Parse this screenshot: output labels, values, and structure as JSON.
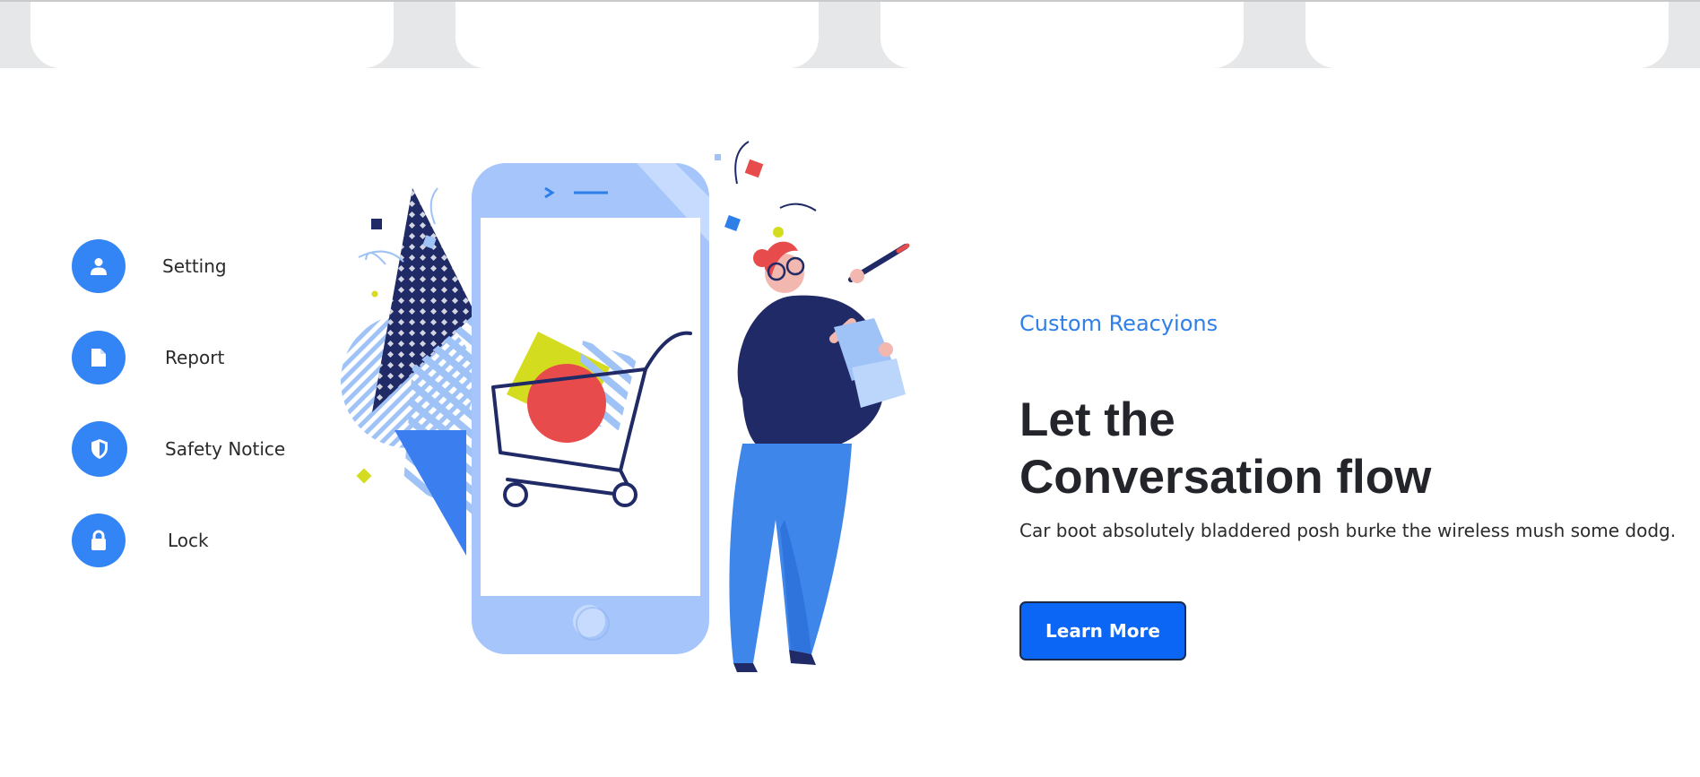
{
  "features": [
    {
      "label": "Setting",
      "icon": "user-icon"
    },
    {
      "label": "Report",
      "icon": "document-icon"
    },
    {
      "label": "Safety Notice",
      "icon": "shield-icon"
    },
    {
      "label": "Lock",
      "icon": "lock-icon"
    }
  ],
  "hero": {
    "eyebrow": "Custom Reacyions",
    "headline_line1": "Let the",
    "headline_line2": "Conversation flow",
    "body": "Car boot absolutely bladdered posh burke the wireless mush some dodg.",
    "cta_label": "Learn More"
  },
  "colors": {
    "accent": "#3385f5",
    "cta": "#0b66f6",
    "eyebrow": "#2f7fe8",
    "headline": "#23252b"
  }
}
